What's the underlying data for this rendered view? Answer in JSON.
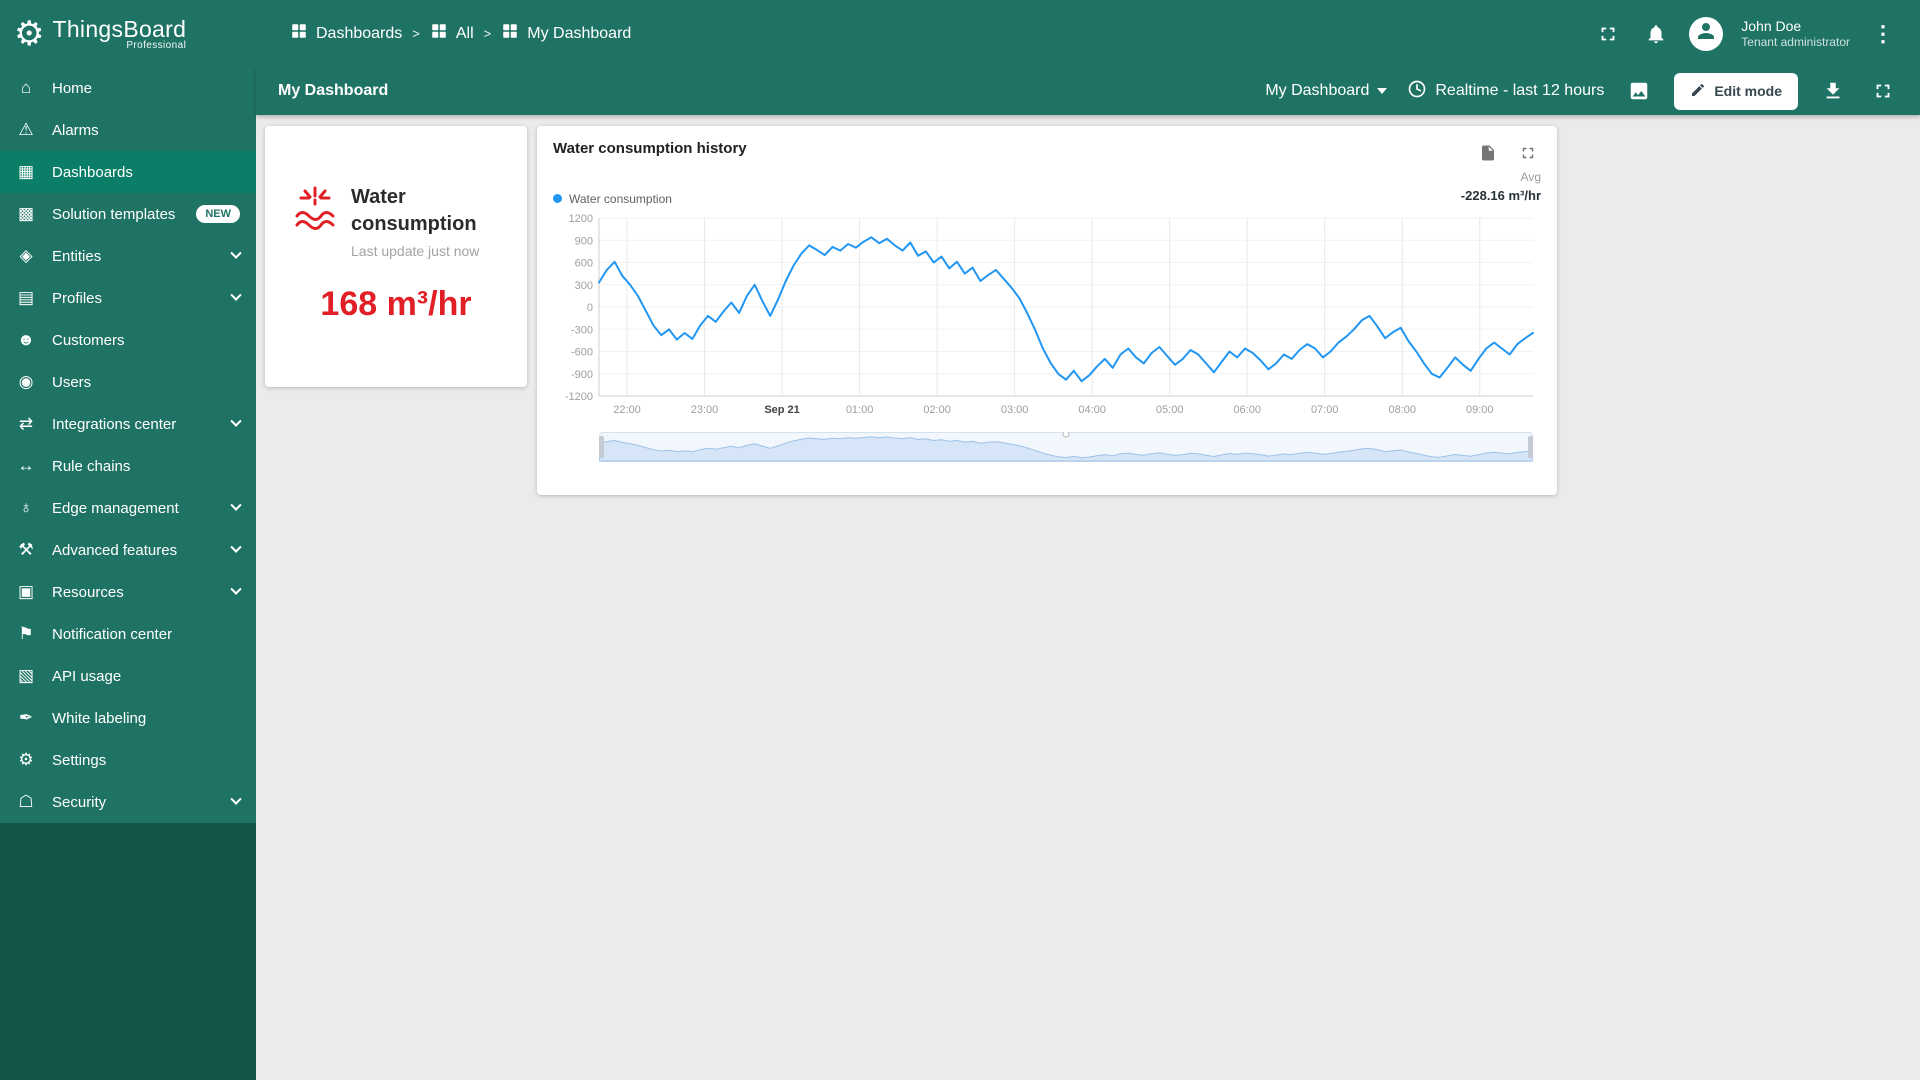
{
  "app": {
    "brand": "ThingsBoard",
    "brand_sub": "Professional"
  },
  "sidebar": {
    "items": [
      {
        "label": "Home",
        "icon": "home"
      },
      {
        "label": "Alarms",
        "icon": "alarms"
      },
      {
        "label": "Dashboards",
        "icon": "dashboards",
        "active": true
      },
      {
        "label": "Solution templates",
        "icon": "solution-templates",
        "badge": "NEW"
      },
      {
        "label": "Entities",
        "icon": "entities",
        "expandable": true
      },
      {
        "label": "Profiles",
        "icon": "profiles",
        "expandable": true
      },
      {
        "label": "Customers",
        "icon": "customers"
      },
      {
        "label": "Users",
        "icon": "users"
      },
      {
        "label": "Integrations center",
        "icon": "integrations",
        "expandable": true
      },
      {
        "label": "Rule chains",
        "icon": "rule-chains"
      },
      {
        "label": "Edge management",
        "icon": "edge",
        "expandable": true
      },
      {
        "label": "Advanced features",
        "icon": "advanced",
        "expandable": true
      },
      {
        "label": "Resources",
        "icon": "resources",
        "expandable": true
      },
      {
        "label": "Notification center",
        "icon": "notifications"
      },
      {
        "label": "API usage",
        "icon": "api"
      },
      {
        "label": "White labeling",
        "icon": "white-labeling"
      },
      {
        "label": "Settings",
        "icon": "settings"
      },
      {
        "label": "Security",
        "icon": "security",
        "expandable": true
      }
    ]
  },
  "header": {
    "breadcrumb": [
      {
        "label": "Dashboards"
      },
      {
        "label": "All"
      },
      {
        "label": "My Dashboard"
      }
    ],
    "user": {
      "name": "John Doe",
      "role": "Tenant administrator"
    }
  },
  "toolbar": {
    "title": "My Dashboard",
    "dashboard_select": "My Dashboard",
    "time_window": "Realtime - last 12 hours",
    "edit_button": "Edit mode"
  },
  "widgets": {
    "water_card": {
      "title": "Water consumption",
      "subtitle": "Last update just now",
      "value": "168 m³/hr"
    },
    "history": {
      "title": "Water consumption history",
      "legend": "Water consumption",
      "agg_label": "Avg",
      "agg_value": "-228.16 m³/hr"
    }
  },
  "colors": {
    "primary": "#1f7365",
    "sidebar_dark": "#14564a",
    "active_item": "#0a7e67",
    "accent_red": "#e01f26",
    "line_blue": "#2196f3"
  },
  "chart_data": {
    "type": "line",
    "title": "Water consumption history",
    "xlabel": "",
    "ylabel": "",
    "ylim": [
      -1200,
      1200
    ],
    "y_ticks": [
      1200,
      900,
      600,
      300,
      0,
      -300,
      -600,
      -900,
      -1200
    ],
    "x_ticks": [
      {
        "label": "22:00",
        "frac": 0.03
      },
      {
        "label": "23:00",
        "frac": 0.113
      },
      {
        "label": "Sep 21",
        "frac": 0.196,
        "bold": true
      },
      {
        "label": "01:00",
        "frac": 0.279
      },
      {
        "label": "02:00",
        "frac": 0.362
      },
      {
        "label": "03:00",
        "frac": 0.445
      },
      {
        "label": "04:00",
        "frac": 0.528
      },
      {
        "label": "05:00",
        "frac": 0.611
      },
      {
        "label": "06:00",
        "frac": 0.694
      },
      {
        "label": "07:00",
        "frac": 0.777
      },
      {
        "label": "08:00",
        "frac": 0.86
      },
      {
        "label": "09:00",
        "frac": 0.943
      }
    ],
    "legend_position": "top-left",
    "line_color": "#2196f3",
    "avg": "-228.16 m³/hr",
    "series": [
      {
        "name": "Water consumption",
        "values": [
          330,
          500,
          610,
          420,
          300,
          150,
          -50,
          -250,
          -380,
          -300,
          -440,
          -350,
          -430,
          -250,
          -120,
          -200,
          -60,
          60,
          -80,
          150,
          300,
          80,
          -120,
          100,
          350,
          560,
          720,
          830,
          770,
          700,
          810,
          760,
          850,
          800,
          880,
          940,
          860,
          920,
          830,
          760,
          870,
          690,
          750,
          600,
          680,
          520,
          610,
          450,
          530,
          350,
          430,
          500,
          380,
          260,
          120,
          -80,
          -300,
          -550,
          -750,
          -900,
          -980,
          -860,
          -1000,
          -920,
          -800,
          -700,
          -820,
          -640,
          -560,
          -680,
          -760,
          -620,
          -540,
          -660,
          -780,
          -700,
          -580,
          -640,
          -760,
          -880,
          -740,
          -600,
          -680,
          -560,
          -620,
          -720,
          -840,
          -760,
          -640,
          -700,
          -580,
          -500,
          -560,
          -680,
          -600,
          -480,
          -400,
          -300,
          -180,
          -120,
          -260,
          -420,
          -340,
          -280,
          -460,
          -600,
          -760,
          -900,
          -950,
          -820,
          -680,
          -780,
          -860,
          -700,
          -560,
          -480,
          -560,
          -640,
          -500,
          -420,
          -350
        ]
      }
    ]
  }
}
